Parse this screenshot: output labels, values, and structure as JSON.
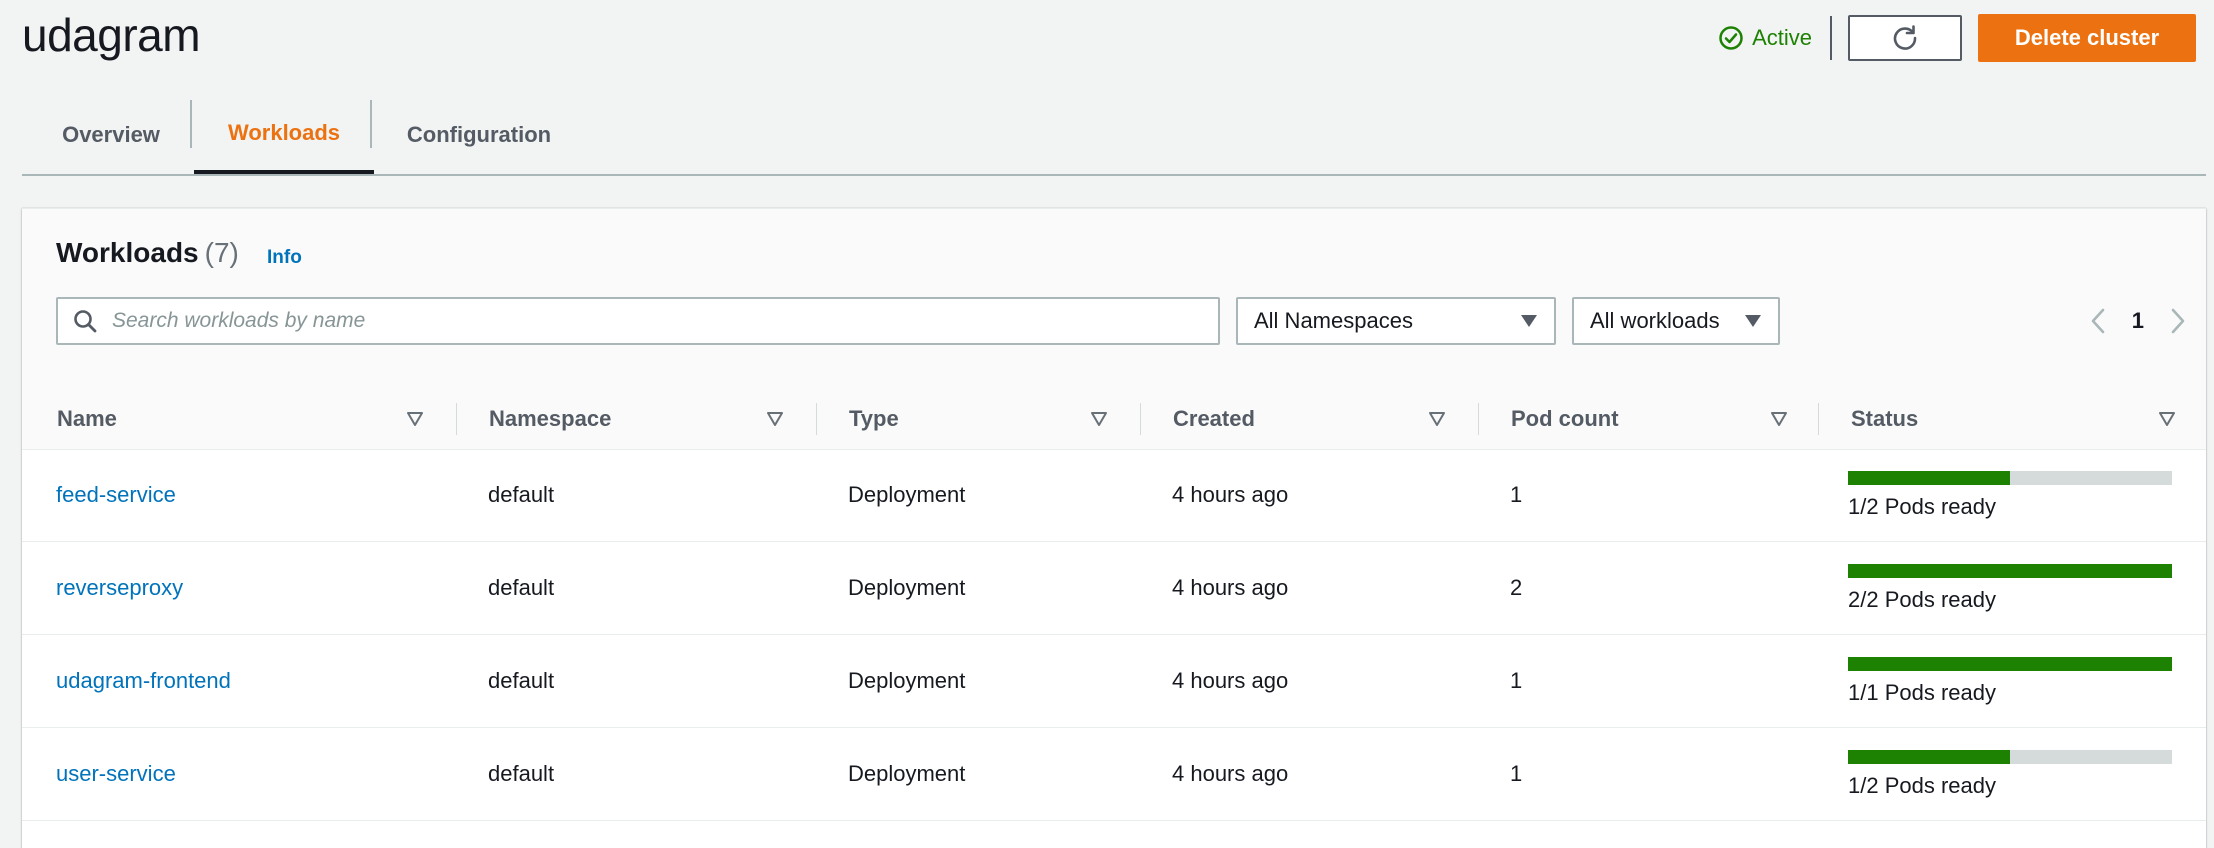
{
  "page": {
    "title": "udagram",
    "status": "Active",
    "delete_label": "Delete cluster",
    "colors": {
      "accent": "#ec7211",
      "link": "#0073bb",
      "success": "#1d8102"
    }
  },
  "tabs": [
    {
      "label": "Overview",
      "active": false
    },
    {
      "label": "Workloads",
      "active": true
    },
    {
      "label": "Configuration",
      "active": false
    }
  ],
  "workloads": {
    "title": "Workloads",
    "count": "(7)",
    "info": "Info",
    "search_placeholder": "Search workloads by name",
    "namespace_filter": "All Namespaces",
    "type_filter": "All workloads",
    "page": "1",
    "columns": [
      "Name",
      "Namespace",
      "Type",
      "Created",
      "Pod count",
      "Status"
    ],
    "rows": [
      {
        "name": "feed-service",
        "namespace": "default",
        "type": "Deployment",
        "created": "4 hours ago",
        "pod_count": "1",
        "status": "1/2 Pods ready",
        "ready_fraction": 0.5
      },
      {
        "name": "reverseproxy",
        "namespace": "default",
        "type": "Deployment",
        "created": "4 hours ago",
        "pod_count": "2",
        "status": "2/2 Pods ready",
        "ready_fraction": 1.0
      },
      {
        "name": "udagram-frontend",
        "namespace": "default",
        "type": "Deployment",
        "created": "4 hours ago",
        "pod_count": "1",
        "status": "1/1 Pods ready",
        "ready_fraction": 1.0
      },
      {
        "name": "user-service",
        "namespace": "default",
        "type": "Deployment",
        "created": "4 hours ago",
        "pod_count": "1",
        "status": "1/2 Pods ready",
        "ready_fraction": 0.5
      }
    ]
  },
  "icons": {
    "status": "check-circle-icon",
    "refresh": "refresh-icon",
    "search": "search-icon",
    "dropdown": "caret-down-icon",
    "sort": "sort-icon",
    "prev": "chevron-left-icon",
    "next": "chevron-right-icon"
  }
}
